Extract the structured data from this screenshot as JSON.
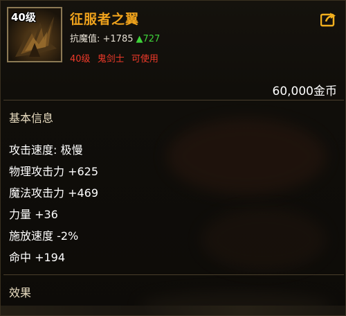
{
  "item": {
    "level_badge": "40级",
    "name": "征服者之翼",
    "resist_label": "抗魔值: +1785",
    "resist_increase": "▲727",
    "requirements": [
      "40级",
      "鬼剑士",
      "可使用"
    ],
    "price": "60,000金币"
  },
  "sections": {
    "basic_info": "基本信息",
    "effects": "效果"
  },
  "stats": [
    "攻击速度: 极慢",
    "物理攻击力 +625",
    "魔法攻击力 +469",
    "力量 +36",
    "施放速度 -2%",
    "命中 +194"
  ],
  "colors": {
    "item_name": "#f0a31c",
    "resist_increase": "#3fd23a",
    "requirement": "#f03a2a",
    "share_icon": "#f2b01e"
  },
  "icons": {
    "share": "share-icon",
    "item": "wings-item-icon"
  }
}
